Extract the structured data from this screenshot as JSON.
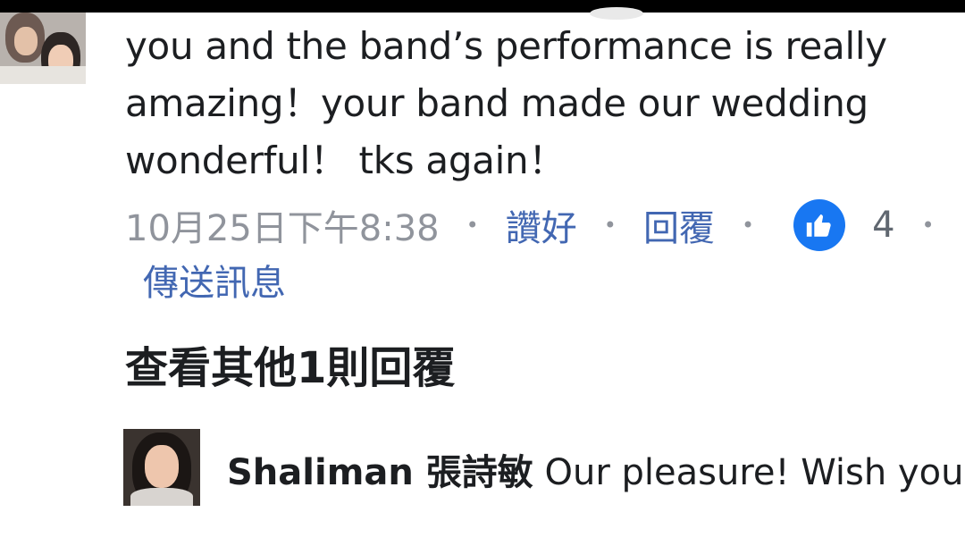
{
  "comment": {
    "text": "you and the band’s performance is really amazing！your band made our wedding wonderful！ tks again！",
    "timestamp": "10月25日下午8:38",
    "like_label": "讚好",
    "reply_label": "回覆",
    "like_count": "4",
    "message_label": "傳送訊息",
    "separator": "•"
  },
  "view_more_replies": "查看其他1則回覆",
  "reply": {
    "author": "Shaliman 張詩敏",
    "text": "Our pleasure! Wish you"
  },
  "colors": {
    "link": "#4267b2",
    "meta": "#90949c",
    "like_badge": "#1877f2",
    "text": "#1c1e21"
  },
  "icons": {
    "like": "thumbs-up-icon"
  }
}
